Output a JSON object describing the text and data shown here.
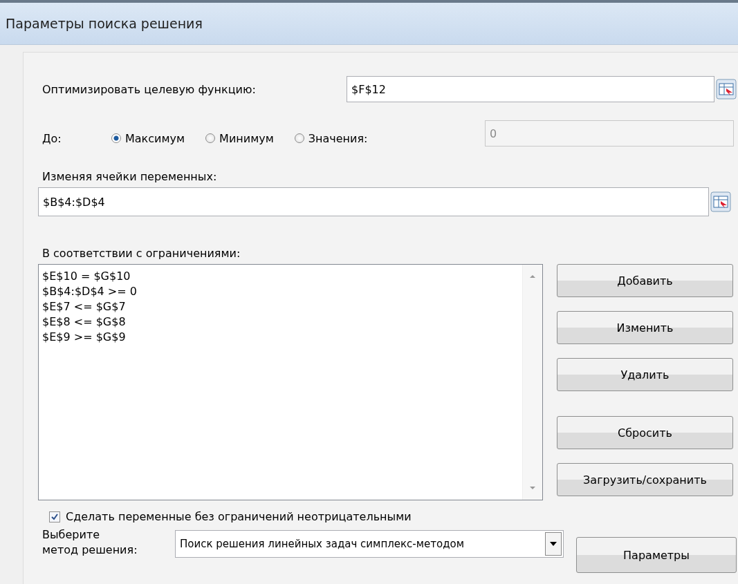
{
  "window": {
    "title": "Параметры поиска решения"
  },
  "objective": {
    "label": "Оптимизировать целевую функцию:",
    "value": "$F$12"
  },
  "to": {
    "label": "До:",
    "options": [
      {
        "label": "Максимум",
        "selected": true
      },
      {
        "label": "Минимум",
        "selected": false
      },
      {
        "label": "Значения:",
        "selected": false
      }
    ],
    "value_field": {
      "value": "0",
      "disabled": true
    }
  },
  "variables": {
    "label": "Изменяя ячейки переменных:",
    "value": "$B$4:$D$4"
  },
  "constraints": {
    "label": "В соответствии с ограничениями:",
    "items": [
      "$E$10 = $G$10",
      "$B$4:$D$4 >= 0",
      "$E$7 <= $G$7",
      "$E$8 <= $G$8",
      "$E$9 >= $G$9"
    ]
  },
  "buttons": [
    "Добавить",
    "Изменить",
    "Удалить",
    "Сбросить",
    "Загрузить/сохранить"
  ],
  "nonnegative": {
    "label": "Сделать переменные без ограничений неотрицательными",
    "checked": true
  },
  "method": {
    "label_lines": [
      "Выберите",
      "метод решения:"
    ],
    "value": "Поиск решения линейных задач симплекс-методом"
  },
  "options_button": "Параметры"
}
